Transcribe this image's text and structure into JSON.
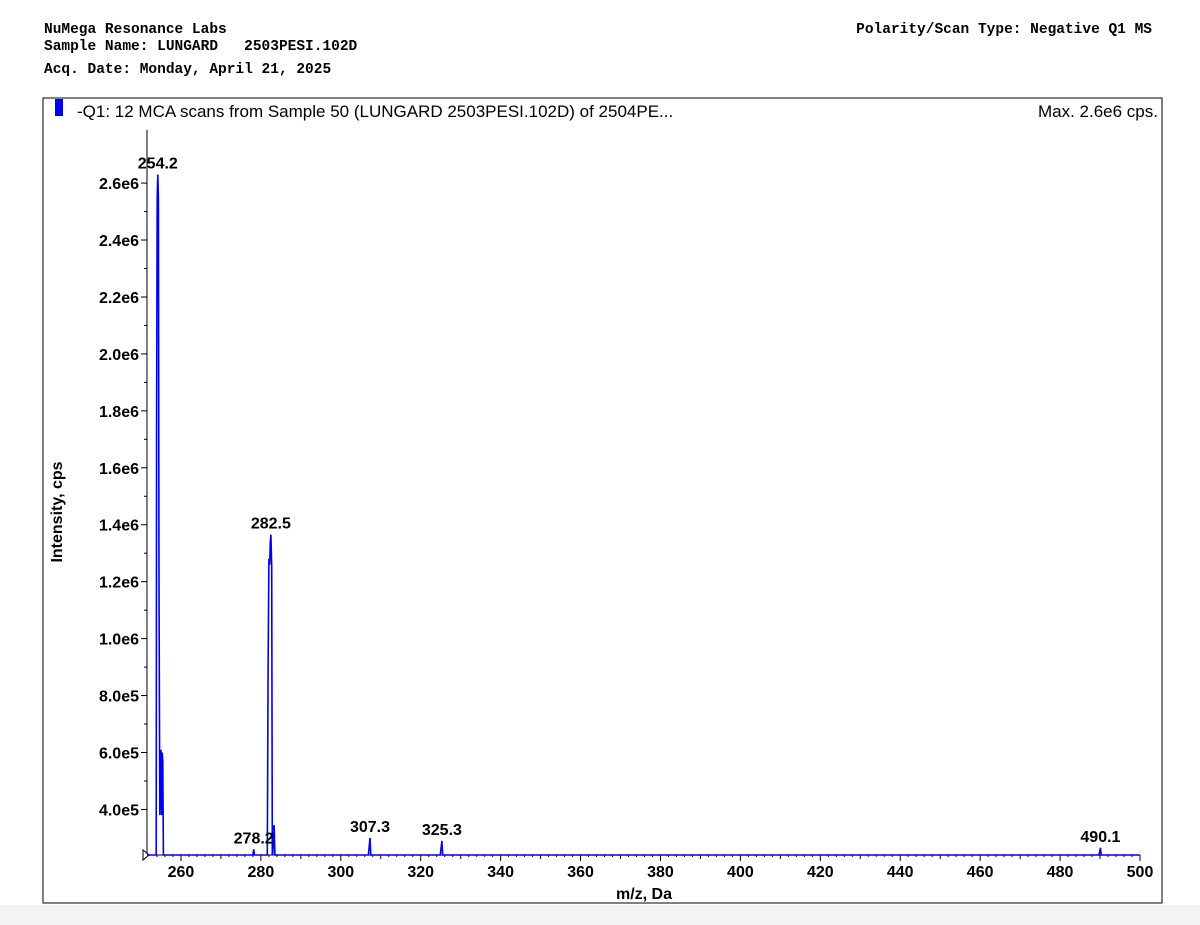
{
  "header": {
    "lab_name": "NuMega Resonance Labs",
    "sample_line": "Sample Name: LUNGARD   2503PESI.102D",
    "acq_date": "Acq. Date: Monday, April 21, 2025",
    "polarity": "Polarity/Scan Type: Negative Q1 MS"
  },
  "panel": {
    "scan_title": "-Q1: 12 MCA scans from Sample 50 (LUNGARD   2503PESI.102D) of 2504PE...",
    "max_label": "Max. 2.6e6 cps.",
    "legend_color": "#0000ee"
  },
  "chart_data": {
    "type": "line",
    "xlabel": "m/z, Da",
    "ylabel": "Intensity, cps",
    "xlim": [
      251.5,
      500
    ],
    "ylim": [
      240000,
      2660000
    ],
    "x_ticks": [
      260,
      280,
      300,
      320,
      340,
      360,
      380,
      400,
      420,
      440,
      460,
      480,
      500
    ],
    "x_tick_labels": [
      "260",
      "280",
      "300",
      "320",
      "340",
      "360",
      "380",
      "400",
      "420",
      "440",
      "460",
      "480",
      "500"
    ],
    "y_ticks": [
      400000,
      600000,
      800000,
      1000000,
      1200000,
      1400000,
      1600000,
      1800000,
      2000000,
      2200000,
      2400000,
      2600000
    ],
    "y_tick_labels": [
      "4.0e5",
      "6.0e5",
      "8.0e5",
      "1.0e6",
      "1.2e6",
      "1.4e6",
      "1.6e6",
      "1.8e6",
      "2.0e6",
      "2.2e6",
      "2.4e6",
      "2.6e6"
    ],
    "series": [
      {
        "color": "#0000ee",
        "x": [
          251.5,
          253.8,
          253.9,
          254.05,
          254.2,
          254.35,
          254.5,
          254.7,
          254.9,
          255.0,
          255.15,
          255.3,
          255.45,
          255.6,
          255.8,
          256.0,
          256.3,
          278.0,
          278.2,
          278.4,
          281.6,
          281.8,
          282.0,
          282.2,
          282.35,
          282.5,
          282.7,
          282.85,
          283.0,
          283.15,
          283.3,
          283.5,
          283.7,
          283.9,
          306.9,
          307.1,
          307.3,
          307.5,
          324.9,
          325.1,
          325.3,
          325.5,
          489.7,
          489.9,
          490.1,
          490.3,
          500
        ],
        "values": [
          240000,
          240000,
          1800000,
          2550000,
          2630000,
          2550000,
          1200000,
          380000,
          580000,
          610000,
          380000,
          600000,
          570000,
          240000,
          240000,
          240000,
          240000,
          240000,
          260000,
          240000,
          240000,
          900000,
          1280000,
          1260000,
          1340000,
          1365000,
          1250000,
          240000,
          250000,
          330000,
          345000,
          240000,
          240000,
          240000,
          240000,
          270000,
          300000,
          240000,
          240000,
          265000,
          290000,
          240000,
          240000,
          250000,
          265000,
          240000,
          240000
        ]
      }
    ],
    "peak_labels": [
      {
        "x": 254.2,
        "y": 2630000,
        "text": "254.2"
      },
      {
        "x": 282.5,
        "y": 1365000,
        "text": "282.5"
      },
      {
        "x": 278.2,
        "y": 260000,
        "text": "278.2"
      },
      {
        "x": 307.3,
        "y": 300000,
        "text": "307.3"
      },
      {
        "x": 325.3,
        "y": 290000,
        "text": "325.3"
      },
      {
        "x": 490.1,
        "y": 265000,
        "text": "490.1"
      }
    ],
    "grid": false,
    "legend": "top-left"
  }
}
